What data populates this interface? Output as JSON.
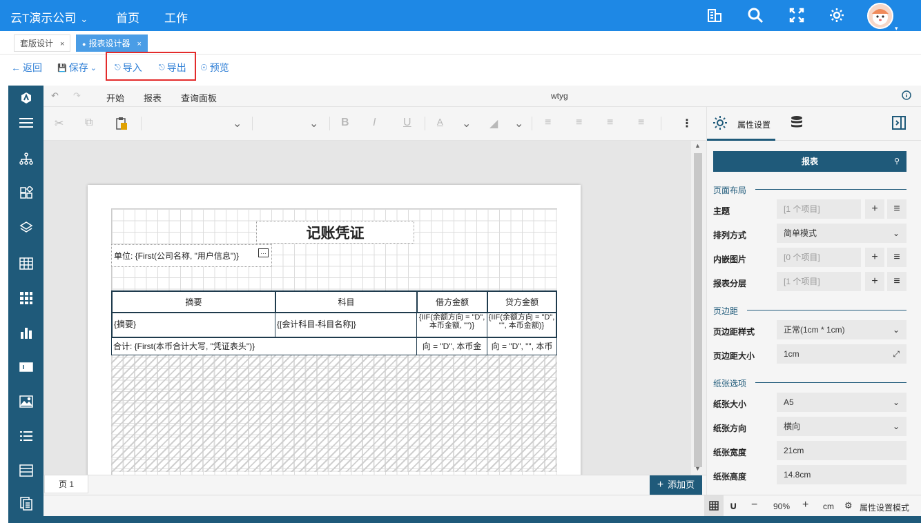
{
  "topbar": {
    "brand": "云T演示公司",
    "nav": [
      "首页",
      "工作"
    ],
    "icons": [
      "building-icon",
      "search-icon",
      "fullscreen-icon",
      "settings-icon"
    ]
  },
  "tabs": [
    {
      "label": "套版设计",
      "close": "×"
    },
    {
      "label": "报表设计器",
      "close": "×"
    }
  ],
  "actions": {
    "back": "返回",
    "save": "保存",
    "import": "导入",
    "export": "导出",
    "preview": "预览"
  },
  "ribbon": {
    "tabs": [
      "开始",
      "报表",
      "查询面板"
    ],
    "doc_name": "wtyg"
  },
  "report": {
    "title": "记账凭证",
    "unit": "单位: {First(公司名称, \"用户信息\")}",
    "headers": [
      "摘要",
      "科目",
      "借方金额",
      "贷方金额"
    ],
    "row1": [
      "{摘要}",
      "{[会计科目-科目名称]}",
      "{IIF(余额方向 = \"D\", 本币金额, \"\")}",
      "{IIF(余额方向 = \"D\", \"\", 本币金额)}"
    ],
    "row2": [
      "合计:  {First(本币合计大写, \"凭证表头\")}",
      "向 = \"D\", 本币金",
      "向 = \"D\", \"\", 本币"
    ]
  },
  "pagebar": {
    "page": "页 1",
    "add_page": "添加页"
  },
  "bottombar": {
    "zoom": "90%",
    "unit": "cm",
    "mode": "属性设置模式"
  },
  "panel": {
    "tab_props": "属性设置",
    "search_target": "报表",
    "sections": {
      "layout": "页面布局",
      "margin": "页边距",
      "paper": "纸张选项"
    },
    "rows": {
      "theme": {
        "label": "主题",
        "value": "[1 个项目]"
      },
      "arrange": {
        "label": "排列方式",
        "value": "简单模式"
      },
      "images": {
        "label": "内嵌图片",
        "value": "[0 个项目]"
      },
      "layers": {
        "label": "报表分层",
        "value": "[1 个项目]"
      },
      "margin_style": {
        "label": "页边距样式",
        "value": "正常(1cm * 1cm)"
      },
      "margin_size": {
        "label": "页边距大小",
        "value": "1cm"
      },
      "paper_size": {
        "label": "纸张大小",
        "value": "A5"
      },
      "orientation": {
        "label": "纸张方向",
        "value": "横向"
      },
      "width": {
        "label": "纸张宽度",
        "value": "21cm"
      },
      "height": {
        "label": "纸张高度",
        "value": "14.8cm"
      }
    }
  }
}
